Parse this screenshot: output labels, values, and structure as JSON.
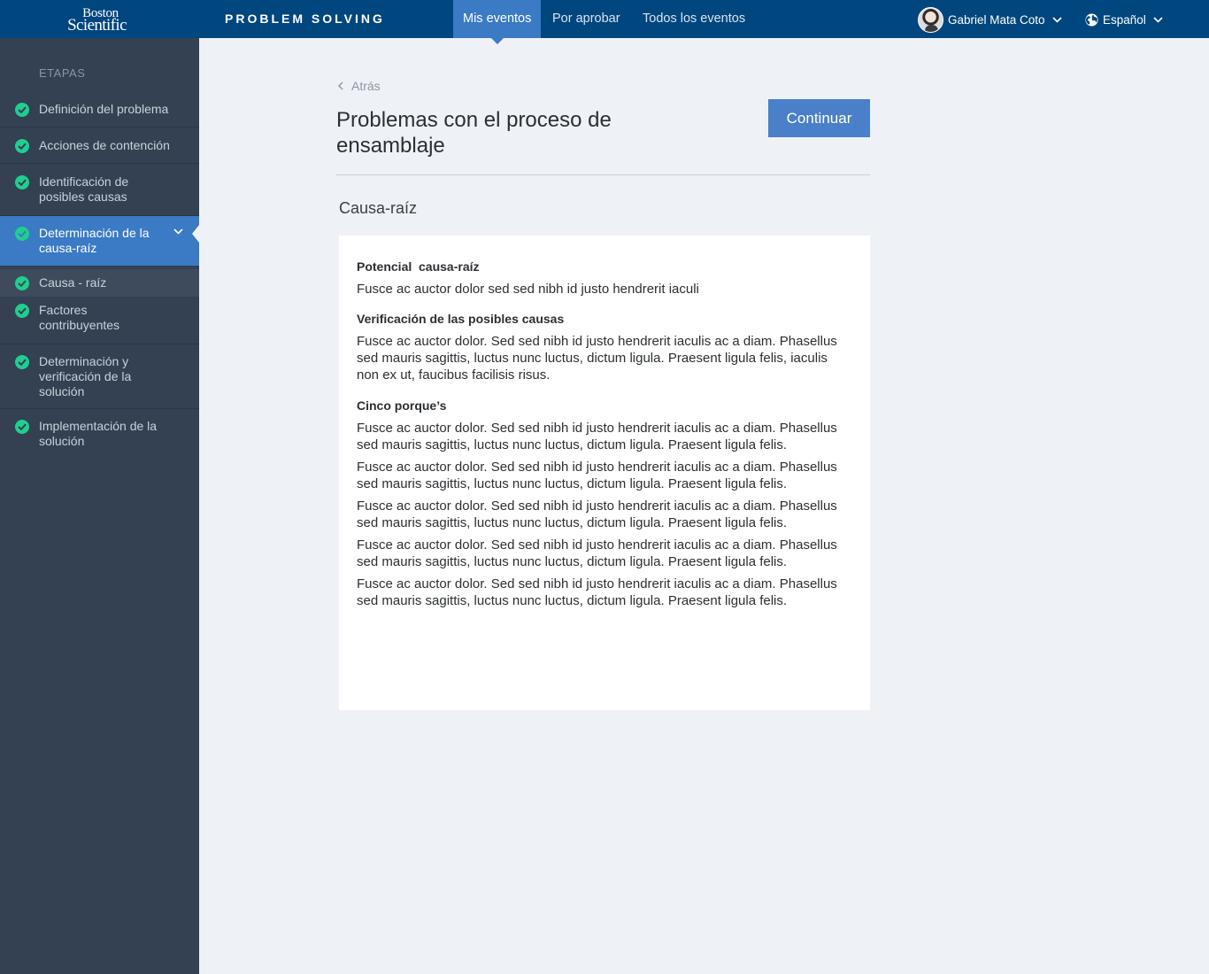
{
  "header": {
    "logo_line1": "Boston",
    "logo_line2": "Scientific",
    "app_title": "PROBLEM SOLVING",
    "tabs": [
      {
        "label": "Mis eventos",
        "active": true
      },
      {
        "label": "Por aprobar",
        "active": false
      },
      {
        "label": "Todos los eventos",
        "active": false
      }
    ],
    "user_name": "Gabriel Mata Coto",
    "language": "Español",
    "colors": {
      "bar": "#00467f",
      "active_tab": "#3b7ac4"
    }
  },
  "sidebar": {
    "heading": "ETAPAS",
    "steps": [
      {
        "label": "Definición del problema",
        "done": true
      },
      {
        "label": "Acciones de contención",
        "done": true
      },
      {
        "label": "Identificación de posibles causas",
        "done": true
      },
      {
        "label": "Determinación de la causa-raíz",
        "done": true,
        "active": true
      },
      {
        "label": "Causa - raíz",
        "done": true,
        "substep": true
      },
      {
        "label": "Factores contribuyentes",
        "done": true
      },
      {
        "label": "Determinación y verificación de la solución",
        "done": true
      },
      {
        "label": "Implementación de la solución",
        "done": true
      }
    ],
    "icons": {
      "step_status": "check-circle-icon",
      "expand": "chevron-down-icon"
    },
    "colors": {
      "background": "#334152",
      "active": "#3b7ac4",
      "check": "#1fcf8e"
    }
  },
  "main": {
    "back_label": "Atrás",
    "title": "Problemas con el proceso de ensamblaje",
    "continue_label": "Continuar",
    "section_title": "Causa-raíz",
    "card": {
      "potential_heading": "Potencial  causa-raíz",
      "potential_text": "Fusce ac auctor dolor sed sed nibh id justo hendrerit iaculi",
      "verification_heading": "Verificación de las posibles causas",
      "verification_text": "Fusce ac auctor dolor. Sed sed nibh id justo hendrerit iaculis ac a diam. Phasellus sed mauris sagittis, luctus nunc luctus, dictum ligula. Praesent ligula felis, iaculis non ex ut, faucibus facilisis risus.",
      "five_whys_heading": "Cinco porque’s",
      "five_whys": [
        "Fusce ac auctor dolor. Sed sed nibh id justo hendrerit iaculis ac a diam. Phasellus sed mauris sagittis, luctus nunc luctus, dictum ligula. Praesent ligula felis.",
        "Fusce ac auctor dolor. Sed sed nibh id justo hendrerit iaculis ac a diam. Phasellus sed mauris sagittis, luctus nunc luctus, dictum ligula. Praesent ligula felis.",
        "Fusce ac auctor dolor. Sed sed nibh id justo hendrerit iaculis ac a diam. Phasellus sed mauris sagittis, luctus nunc luctus, dictum ligula. Praesent ligula felis.",
        "Fusce ac auctor dolor. Sed sed nibh id justo hendrerit iaculis ac a diam. Phasellus sed mauris sagittis, luctus nunc luctus, dictum ligula. Praesent ligula felis.",
        "Fusce ac auctor dolor. Sed sed nibh id justo hendrerit iaculis ac a diam. Phasellus sed mauris sagittis, luctus nunc luctus, dictum ligula. Praesent ligula felis."
      ]
    },
    "colors": {
      "button": "#4a7fc9",
      "page_bg": "#eef1f6"
    }
  }
}
